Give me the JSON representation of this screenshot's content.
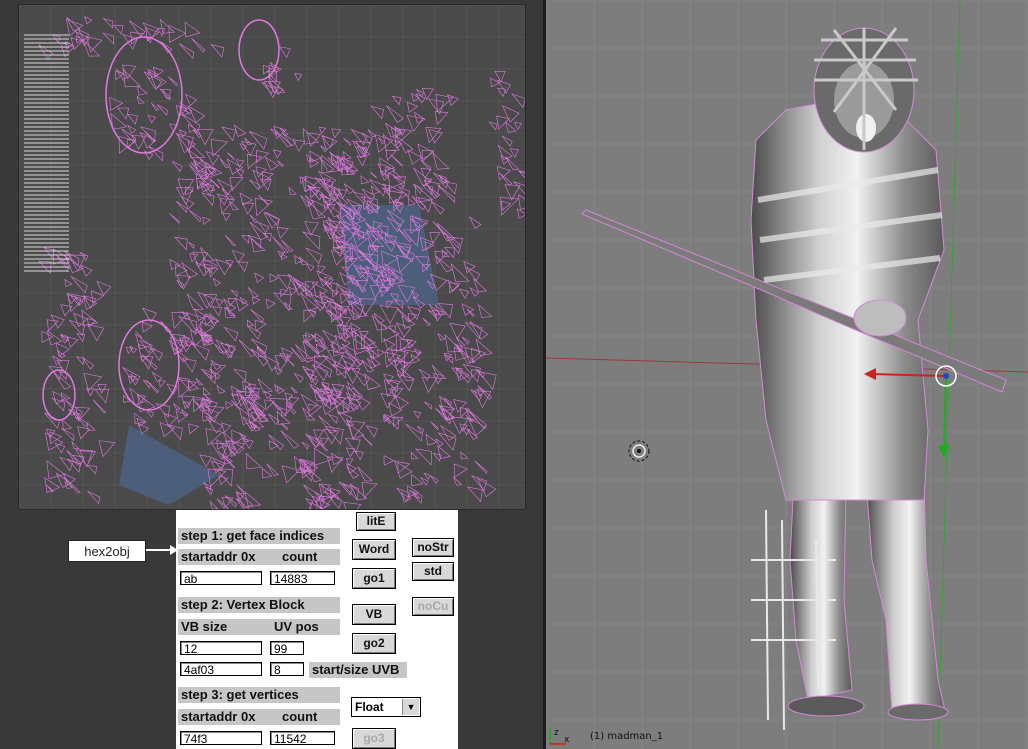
{
  "uv_editor": {
    "wire_color": "#e07ae0",
    "bg_color": "#4a4a4a"
  },
  "tool": {
    "name_label": "hex2obj",
    "step1": {
      "title": "step 1: get face indices",
      "addr_label": "startaddr 0x",
      "count_label": "count",
      "addr_value": "ab",
      "count_value": "14883"
    },
    "step2": {
      "title": "step 2: Vertex Block",
      "vbsize_label": "VB size",
      "uvpos_label": "UV pos",
      "vbsize_value": "12",
      "uvpos_value": "99",
      "uvb_start_value": "4af03",
      "uvb_size_value": "8",
      "uvb_label": "start/size UVB"
    },
    "step3": {
      "title": "step 3: get vertices",
      "addr_label": "startaddr 0x",
      "count_label": "count",
      "addr_value": "74f3",
      "count_value": "11542"
    },
    "buttons": {
      "lite": "litE",
      "word": "Word",
      "go1": "go1",
      "nostr": "noStr",
      "std": "std",
      "vb": "VB",
      "nocu": "noCu",
      "go2": "go2",
      "go3": "go3"
    },
    "float_select": "Float"
  },
  "viewport": {
    "object_name": "(1) madman_1",
    "axis_x": "x",
    "axis_z": "z"
  }
}
